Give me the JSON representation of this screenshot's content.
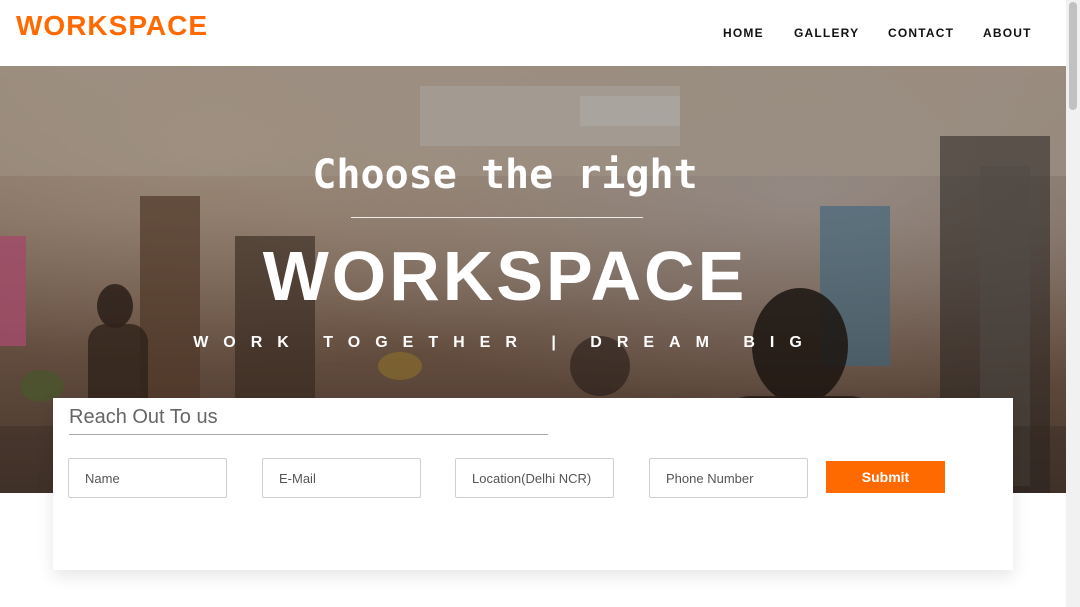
{
  "brand": {
    "logo_text": "WORKSPACE"
  },
  "nav": {
    "items": [
      {
        "label": "HOME"
      },
      {
        "label": "GALLERY"
      },
      {
        "label": "CONTACT"
      },
      {
        "label": "ABOUT"
      }
    ]
  },
  "hero": {
    "subtitle": "Choose the right",
    "title": "WORKSPACE",
    "tagline": "WORK TOGETHER | DREAM BIG"
  },
  "form": {
    "title": "Reach Out To us",
    "fields": [
      {
        "placeholder": "Name"
      },
      {
        "placeholder": "E-Mail"
      },
      {
        "placeholder": "Location(Delhi NCR)"
      },
      {
        "placeholder": "Phone Number"
      }
    ],
    "submit_label": "Submit"
  },
  "colors": {
    "accent": "#ff6a00",
    "nav_text": "#111111"
  }
}
